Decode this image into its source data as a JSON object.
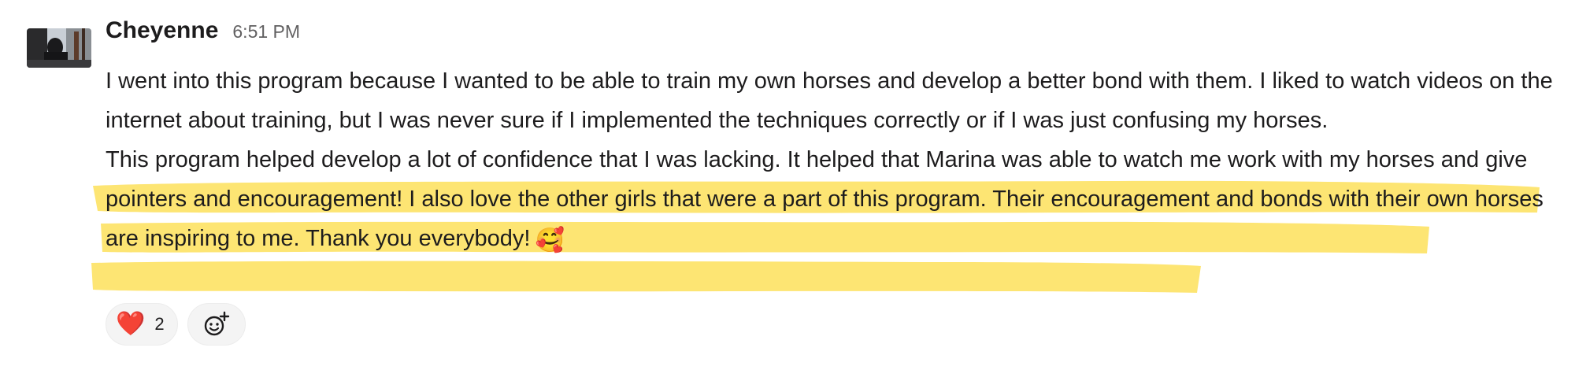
{
  "message": {
    "sender": "Cheyenne",
    "timestamp": "6:51 PM",
    "paragraph_1": "I went into this program because I wanted to be able to train my own horses and develop a better bond with them. I liked to watch videos on the internet about training, but I was never sure if I implemented the techniques correctly or if I was just confusing my horses.",
    "paragraph_2": "This program helped develop a lot of confidence that I was lacking. It helped that Marina was able to watch me work with my horses and give pointers and encouragement! I also love the other girls that were a part of this program. Their encouragement and bonds with their own horses are inspiring to me. Thank you everybody!",
    "paragraph_2_emoji": "🥰",
    "highlight_color": "#fde15a"
  },
  "reactions": [
    {
      "emoji": "❤️",
      "icon": "red-heart-icon",
      "count": "2"
    }
  ],
  "add_reaction": {
    "icon": "add-reaction-icon"
  }
}
